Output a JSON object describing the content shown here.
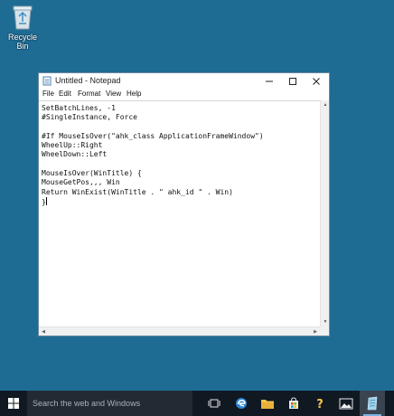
{
  "desktop": {
    "recycle_bin_label": "Recycle Bin"
  },
  "notepad": {
    "title": "Untitled - Notepad",
    "menus": [
      "File",
      "Edit",
      "Format",
      "View",
      "Help"
    ],
    "lines": [
      "SetBatchLines, -1",
      "#SingleInstance, Force",
      "",
      "#If MouseIsOver(\"ahk_class ApplicationFrameWindow\")",
      "WheelUp::Right",
      "WheelDown::Left",
      "",
      "MouseIsOver(WinTitle) {",
      "MouseGetPos,,, Win",
      "Return WinExist(WinTitle . \" ahk_id \" . Win)",
      "}"
    ]
  },
  "taskbar": {
    "search_placeholder": "Search the web and Windows",
    "icons": [
      "task-view-icon",
      "edge-icon",
      "file-explorer-icon",
      "store-icon",
      "help-icon",
      "photos-icon",
      "notepad-icon"
    ],
    "accent_color": "#7fb2e6"
  }
}
